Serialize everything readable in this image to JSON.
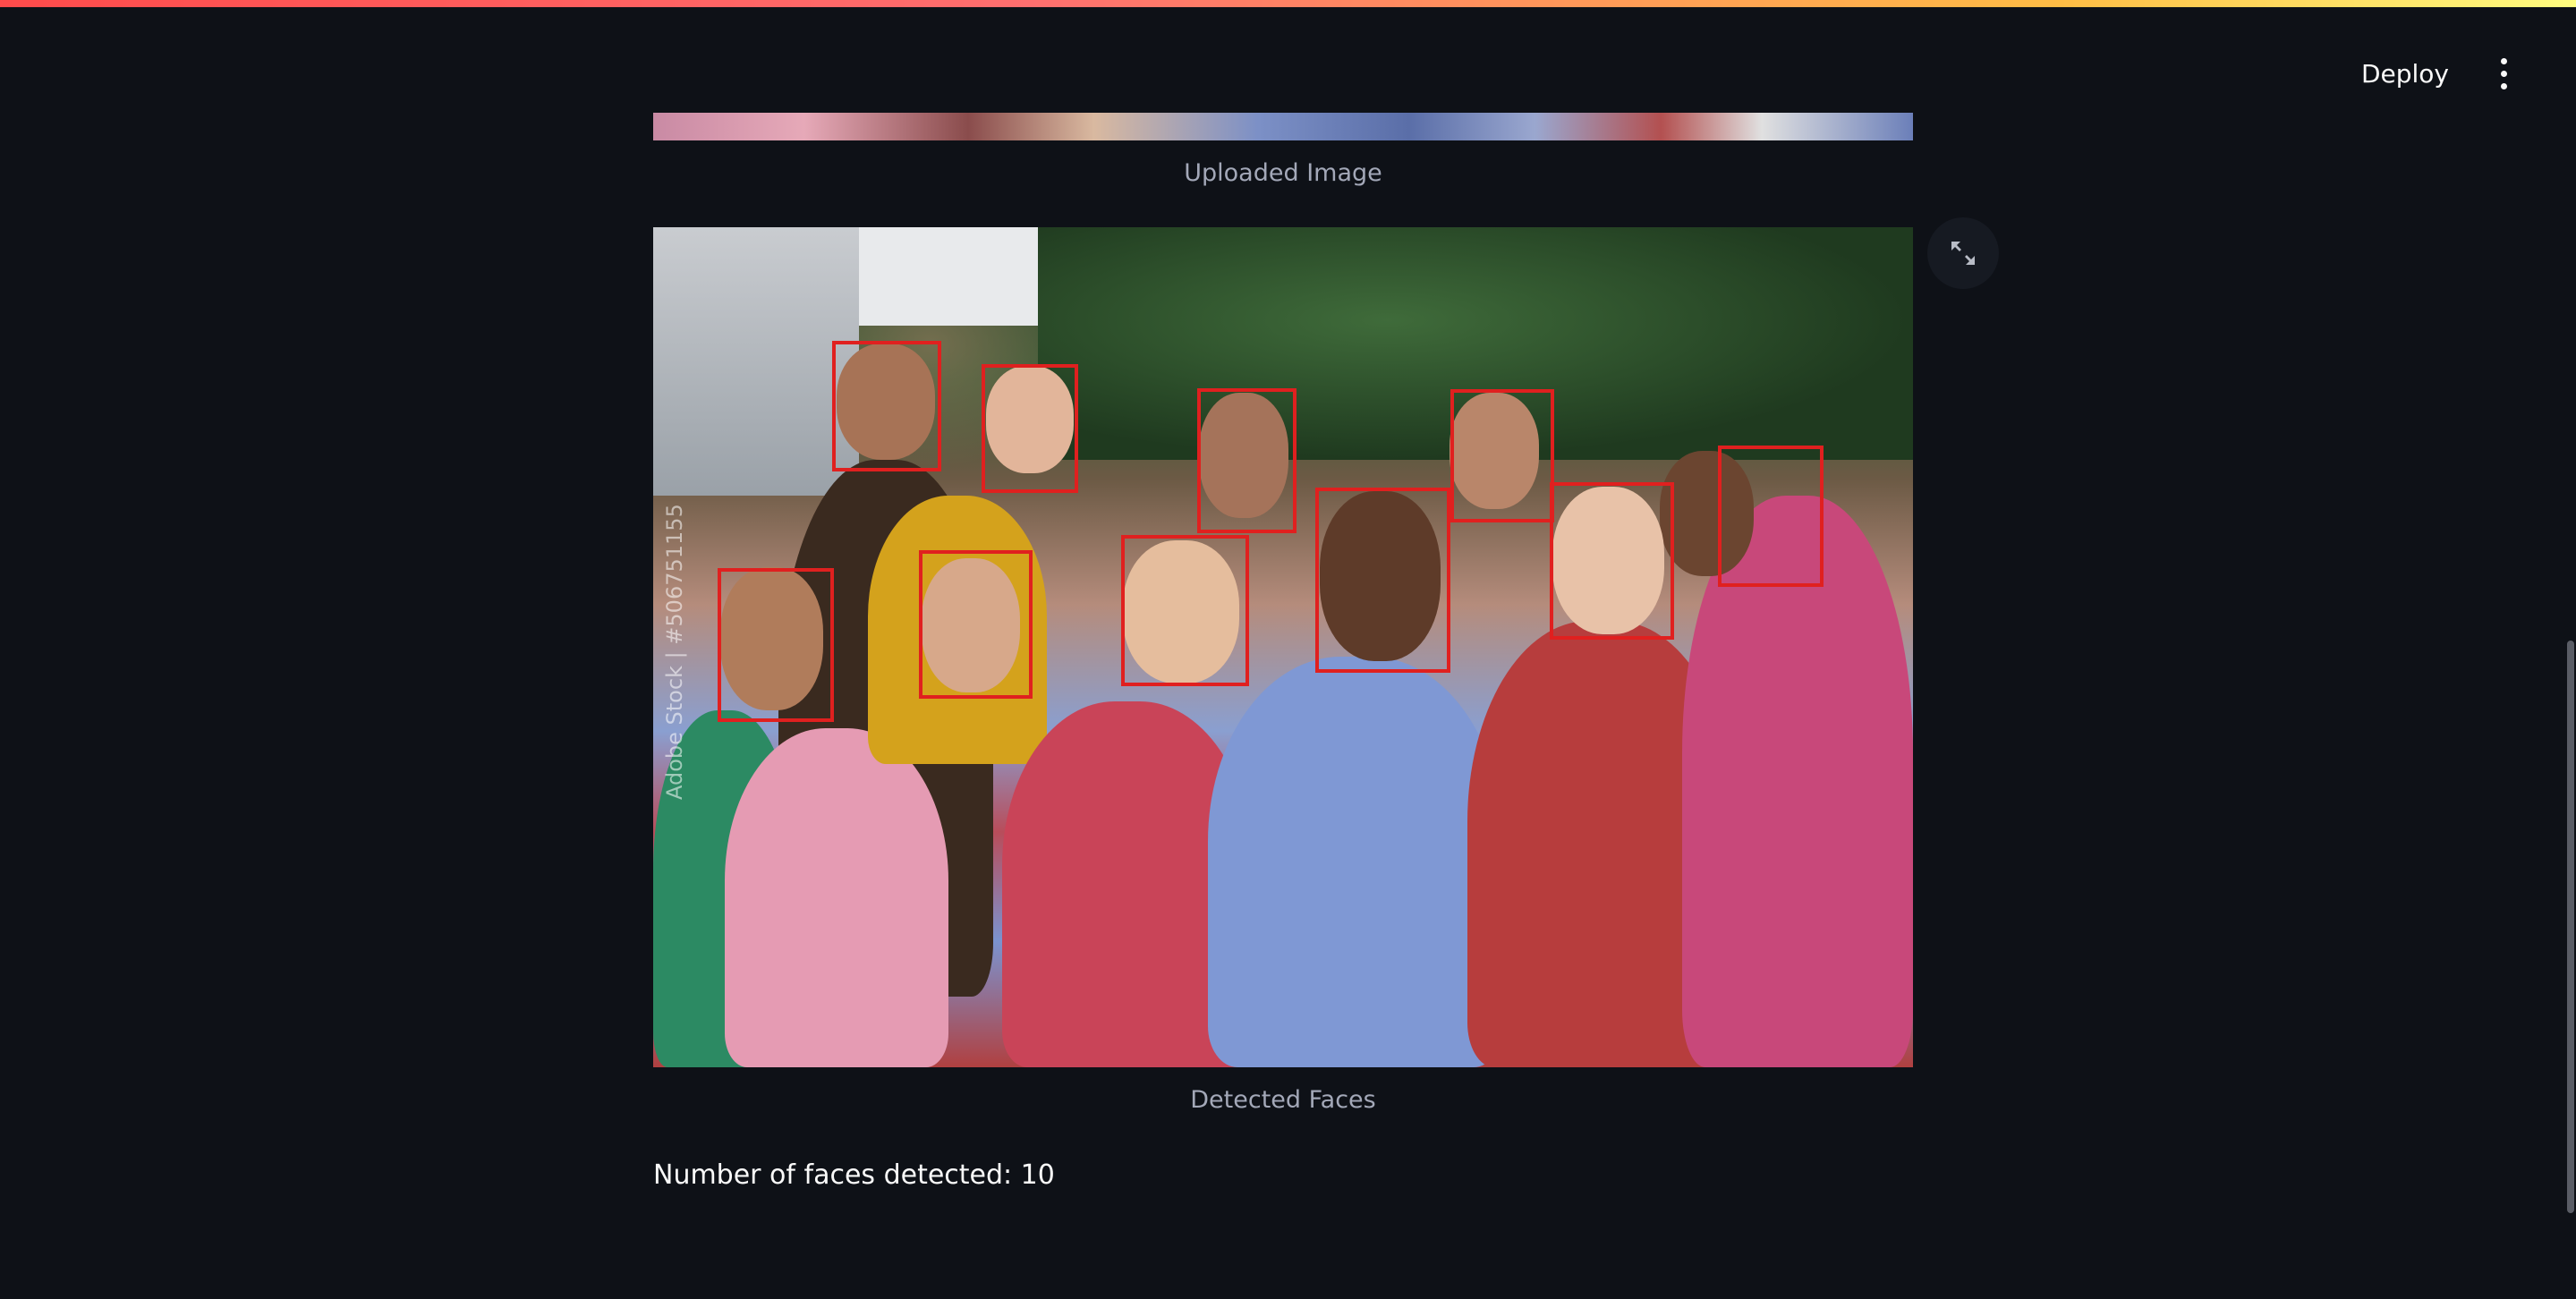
{
  "header": {
    "deploy_label": "Deploy",
    "menu_icon": "vertical-ellipsis-icon"
  },
  "uploaded": {
    "caption": "Uploaded Image"
  },
  "detected": {
    "caption": "Detected Faces",
    "watermark": "Adobe Stock | #506751155",
    "fullscreen_icon": "expand-arrows-icon"
  },
  "result": {
    "count_text": "Number of faces detected: 10"
  },
  "colors": {
    "background": "#0e1117",
    "box": "#e0201f",
    "caption": "#a3a8b8"
  }
}
